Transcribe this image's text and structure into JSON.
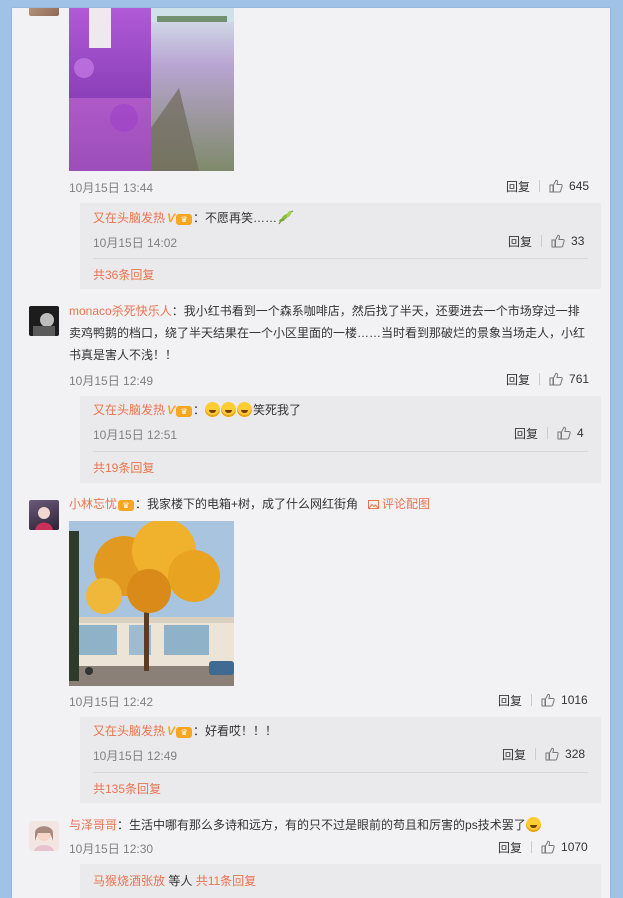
{
  "colors": {
    "accent": "#eb7350",
    "panel_bg": "#f2f2f5",
    "sub_bg": "#eaeaec",
    "page_bg": "#9fc2e6"
  },
  "comments": [
    {
      "time": "10月15日 13:44",
      "reply": "回复",
      "likes": "645",
      "sub": {
        "name": "又在头脑发热",
        "text": "：不愿再笑……",
        "time": "10月15日 14:02",
        "reply": "回复",
        "likes": "33",
        "more": "共36条回复"
      }
    },
    {
      "name": "monaco杀死快乐人",
      "text": "：我小红书看到一个森系咖啡店，然后找了半天，还要进去一个市场穿过一排卖鸡鸭鹅的档口，绕了半天结果在一个小区里面的一楼……当时看到那破烂的景象当场走人，小红书真是害人不浅！！",
      "time": "10月15日 12:49",
      "reply": "回复",
      "likes": "761",
      "sub": {
        "name": "又在头脑发热",
        "prefix": "：",
        "text": "笑死我了",
        "time": "10月15日 12:51",
        "reply": "回复",
        "likes": "4",
        "more": "共19条回复"
      }
    },
    {
      "name": "小林忘忧",
      "text": "：我家楼下的电箱+树，成了什么网红街角",
      "pic_link": "评论配图",
      "time": "10月15日 12:42",
      "reply": "回复",
      "likes": "1016",
      "sub": {
        "name": "又在头脑发热",
        "text": "：好看哎！！！",
        "time": "10月15日 12:49",
        "reply": "回复",
        "likes": "328",
        "more": "共135条回复"
      }
    },
    {
      "name": "与泽哥哥",
      "text": "：生活中哪有那么多诗和远方，有的只不过是眼前的苟且和厉害的ps技术罢了",
      "time": "10月15日 12:30",
      "reply": "回复",
      "likes": "1070",
      "sub": {
        "name": "马猴烧酒张放",
        "text": " 等人 ",
        "more": "共11条回复"
      }
    }
  ]
}
